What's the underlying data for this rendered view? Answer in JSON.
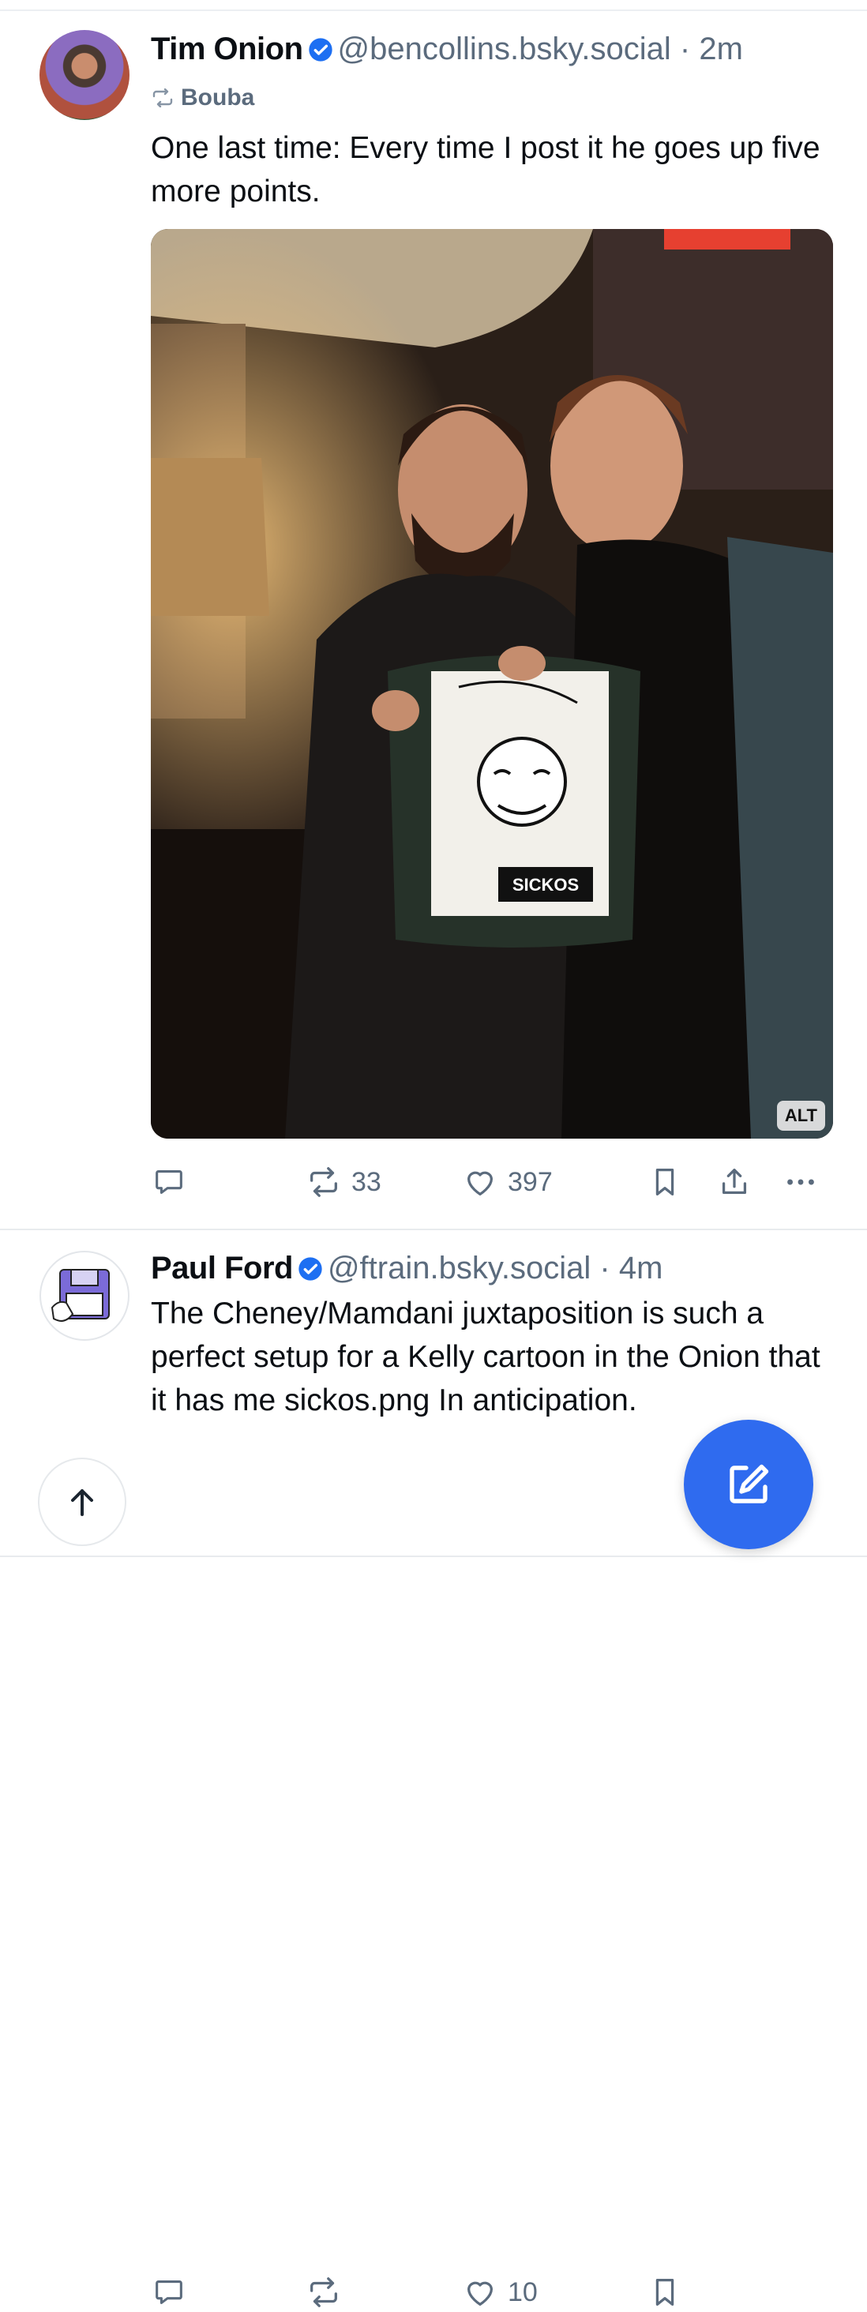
{
  "posts": [
    {
      "author_name": "Tim Onion",
      "handle": "@bencollins.bsky.social",
      "separator": "·",
      "time": "2m",
      "reposted_by": "Bouba",
      "text": "One last time: Every time I post it he goes up five more points.",
      "image_alt_badge": "ALT",
      "image_sign_text": "SICKOS",
      "reply_count": "",
      "repost_count": "33",
      "like_count": "397"
    },
    {
      "author_name": "Paul Ford",
      "handle": "@ftrain.bsky.social",
      "separator": "·",
      "time": "4m",
      "text": "The Cheney/Mamdani juxtaposition is such a perfect setup for a Kelly cartoon in the Onion that it has me sickos.png In anticipation.",
      "reply_count": "",
      "repost_count": "",
      "like_count": "10"
    }
  ],
  "icons": {
    "verified": "verified-check-icon",
    "repost": "repost-icon",
    "reply": "reply-icon",
    "like": "heart-icon",
    "bookmark": "bookmark-icon",
    "share": "share-icon",
    "more": "more-icon",
    "compose": "compose-icon",
    "scroll_top": "arrow-up-icon"
  },
  "colors": {
    "accent": "#2f6bef",
    "verified": "#1d6ff2",
    "muted": "#5b6b7d"
  }
}
